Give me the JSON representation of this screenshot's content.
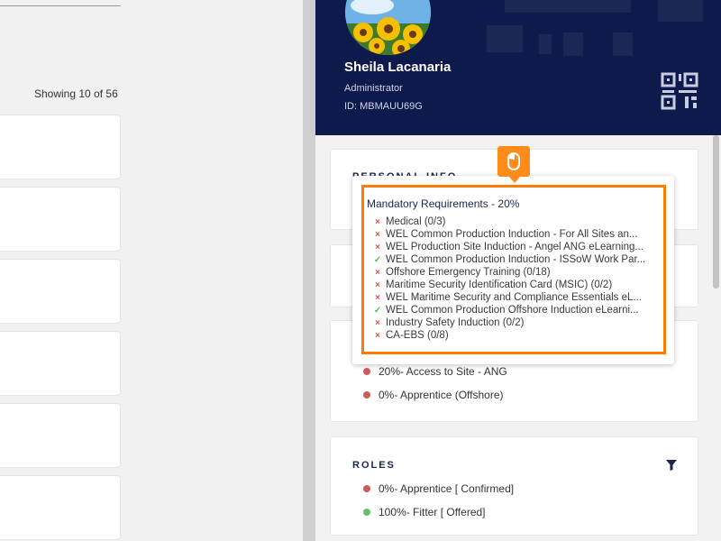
{
  "left": {
    "showing_text": "Showing 10 of 56"
  },
  "profile": {
    "name": "Sheila Lacanaria",
    "role": "Administrator",
    "id": "ID: MBMAUU69G"
  },
  "panels": {
    "personal_info_title": "PERSONAL INFO",
    "requirements": [
      {
        "label": "20%- Access to Site - ANG",
        "status": "incomplete"
      },
      {
        "label": "0%- Apprentice (Offshore)",
        "status": "incomplete"
      }
    ],
    "roles_title": "ROLES",
    "roles": [
      {
        "label": "0%- Apprentice [ Confirmed]",
        "status": "incomplete"
      },
      {
        "label": "100%- Fitter [ Offered]",
        "status": "complete"
      }
    ]
  },
  "tooltip": {
    "title": "Mandatory Requirements - 20%",
    "items": [
      {
        "mark": "cross",
        "text": "Medical (0/3)"
      },
      {
        "mark": "cross",
        "text": "WEL Common Production Induction - For All Sites an..."
      },
      {
        "mark": "cross",
        "text": "WEL Production Site Induction - Angel ANG eLearning..."
      },
      {
        "mark": "check",
        "text": "WEL Common Production Induction - ISSoW Work Par..."
      },
      {
        "mark": "cross",
        "text": "Offshore Emergency Training (0/18)"
      },
      {
        "mark": "cross",
        "text": "Maritime Security Identification Card (MSIC) (0/2)"
      },
      {
        "mark": "cross",
        "text": "WEL Maritime Security and Compliance Essentials eL..."
      },
      {
        "mark": "check",
        "text": "WEL Common Production Offshore Induction eLearni..."
      },
      {
        "mark": "cross",
        "text": "Industry Safety Induction (0/2)"
      },
      {
        "mark": "cross",
        "text": "CA-EBS (0/8)"
      }
    ]
  },
  "icons": {
    "cross": "×",
    "check": "✓",
    "qr": "qr-code-icon",
    "filter": "filter-icon",
    "mouse": "mouse-icon"
  },
  "colors": {
    "header_bg": "#0e1a4b",
    "highlight": "#ff7a00",
    "cross": "#d9534f",
    "check": "#5cb85c",
    "dot_red": "#d05a5a",
    "dot_green": "#6bbf6b"
  }
}
